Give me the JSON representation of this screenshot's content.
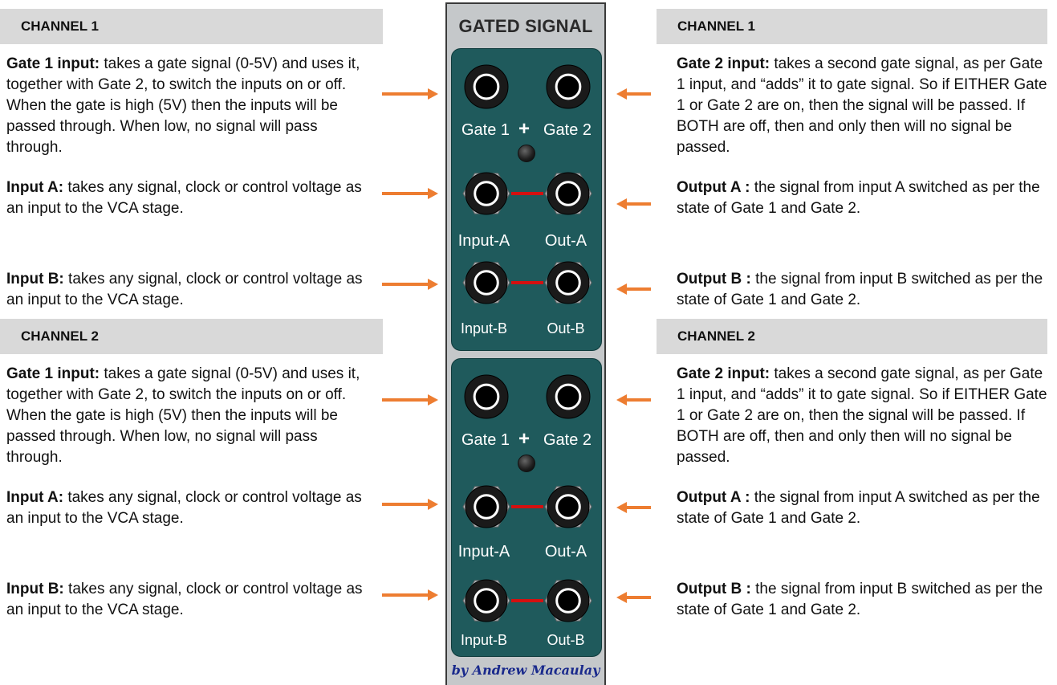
{
  "module": {
    "title": "GATED SIGNAL",
    "credit": "by Andrew Macaulay",
    "channels": [
      {
        "gate1": "Gate 1",
        "plus": "+",
        "gate2": "Gate 2",
        "input_a": "Input-A",
        "out_a": "Out-A",
        "input_b": "Input-B",
        "out_b": "Out-B"
      },
      {
        "gate1": "Gate 1",
        "plus": "+",
        "gate2": "Gate 2",
        "input_a": "Input-A",
        "out_a": "Out-A",
        "input_b": "Input-B",
        "out_b": "Out-B"
      }
    ]
  },
  "left": [
    {
      "heading": "CHANNEL 1",
      "items": [
        {
          "term": "Gate 1 input:",
          "text": " takes a gate signal (0-5V) and uses it, together with Gate 2, to switch the inputs on or off. When the gate is high (5V) then the inputs will be passed through. When low, no signal will pass through."
        },
        {
          "term": "Input A:",
          "text": " takes any signal, clock or control voltage as an input to the VCA stage."
        },
        {
          "term": "Input B:",
          "text": " takes any signal, clock or control voltage as an input to the VCA stage."
        }
      ]
    },
    {
      "heading": "CHANNEL 2",
      "items": [
        {
          "term": "Gate 1 input:",
          "text": " takes a gate signal (0-5V) and uses it, together with Gate 2, to switch the inputs on or off. When the gate is high (5V) then the inputs will be passed through. When low, no signal will pass through."
        },
        {
          "term": "Input A:",
          "text": " takes any signal, clock or control voltage as an input to the VCA stage."
        },
        {
          "term": "Input B:",
          "text": " takes any signal, clock or control voltage as an input to the VCA stage."
        }
      ]
    }
  ],
  "right": [
    {
      "heading": "CHANNEL 1",
      "items": [
        {
          "term": "Gate 2 input:",
          "text": " takes a second gate signal, as per Gate 1 input, and “adds” it to gate signal. So if EITHER Gate 1 or Gate 2 are on, then the signal will be passed. If BOTH are off, then and only then will no signal be passed."
        },
        {
          "term": "Output A :",
          "text": " the signal from input A switched as per the state of Gate 1 and Gate 2."
        },
        {
          "term": "Output B :",
          "text": " the signal from input B switched as per the state of Gate 1 and Gate 2."
        }
      ]
    },
    {
      "heading": "CHANNEL 2",
      "items": [
        {
          "term": "Gate 2 input:",
          "text": " takes a second gate signal, as per Gate 1 input, and “adds” it to gate signal. So if EITHER Gate 1 or Gate 2 are on, then the signal will be passed. If BOTH are off, then and only then will no signal be passed."
        },
        {
          "term": "Output A :",
          "text": " the signal from input A switched as per the state of Gate 1 and Gate 2."
        },
        {
          "term": "Output B :",
          "text": " the signal from input B switched as per the state of Gate 1 and Gate 2."
        }
      ]
    }
  ],
  "colors": {
    "arrow": "#ed7d31",
    "panel": "#c5c8ca",
    "plate": "#1f5a5c",
    "header_band": "#d9d9d9",
    "link": "#d41010",
    "credit": "#1a2a8c"
  }
}
